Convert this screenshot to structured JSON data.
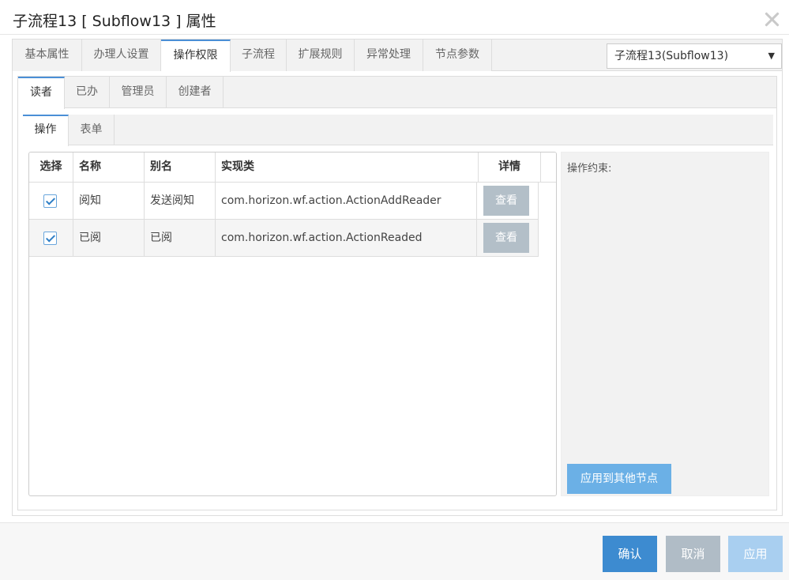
{
  "dialog": {
    "title": "子流程13 [ Subflow13 ] 属性"
  },
  "top_tabs": [
    {
      "label": "基本属性"
    },
    {
      "label": "办理人设置"
    },
    {
      "label": "操作权限",
      "active": true
    },
    {
      "label": "子流程"
    },
    {
      "label": "扩展规则"
    },
    {
      "label": "异常处理"
    },
    {
      "label": "节点参数"
    }
  ],
  "node_select": {
    "value": "子流程13(Subflow13)"
  },
  "role_tabs": [
    {
      "label": "读者",
      "active": true
    },
    {
      "label": "已办"
    },
    {
      "label": "管理员"
    },
    {
      "label": "创建者"
    }
  ],
  "sub_tabs": [
    {
      "label": "操作",
      "active": true
    },
    {
      "label": "表单"
    }
  ],
  "grid": {
    "columns": [
      "选择",
      "名称",
      "别名",
      "实现类",
      "详情"
    ],
    "rows": [
      {
        "checked": true,
        "name": "阅知",
        "alias": "发送阅知",
        "class": "com.horizon.wf.action.ActionAddReader",
        "detail": "查看"
      },
      {
        "checked": true,
        "name": "已阅",
        "alias": "已阅",
        "class": "com.horizon.wf.action.ActionReaded",
        "detail": "查看"
      }
    ]
  },
  "constraint": {
    "label": "操作约束:",
    "apply_button": "应用到其他节点"
  },
  "footer": {
    "ok": "确认",
    "cancel": "取消",
    "apply": "应用"
  },
  "colors": {
    "accent": "#3d8bd0",
    "tab_border": "#4a8fd6",
    "disabled": "#b0bcc6"
  }
}
